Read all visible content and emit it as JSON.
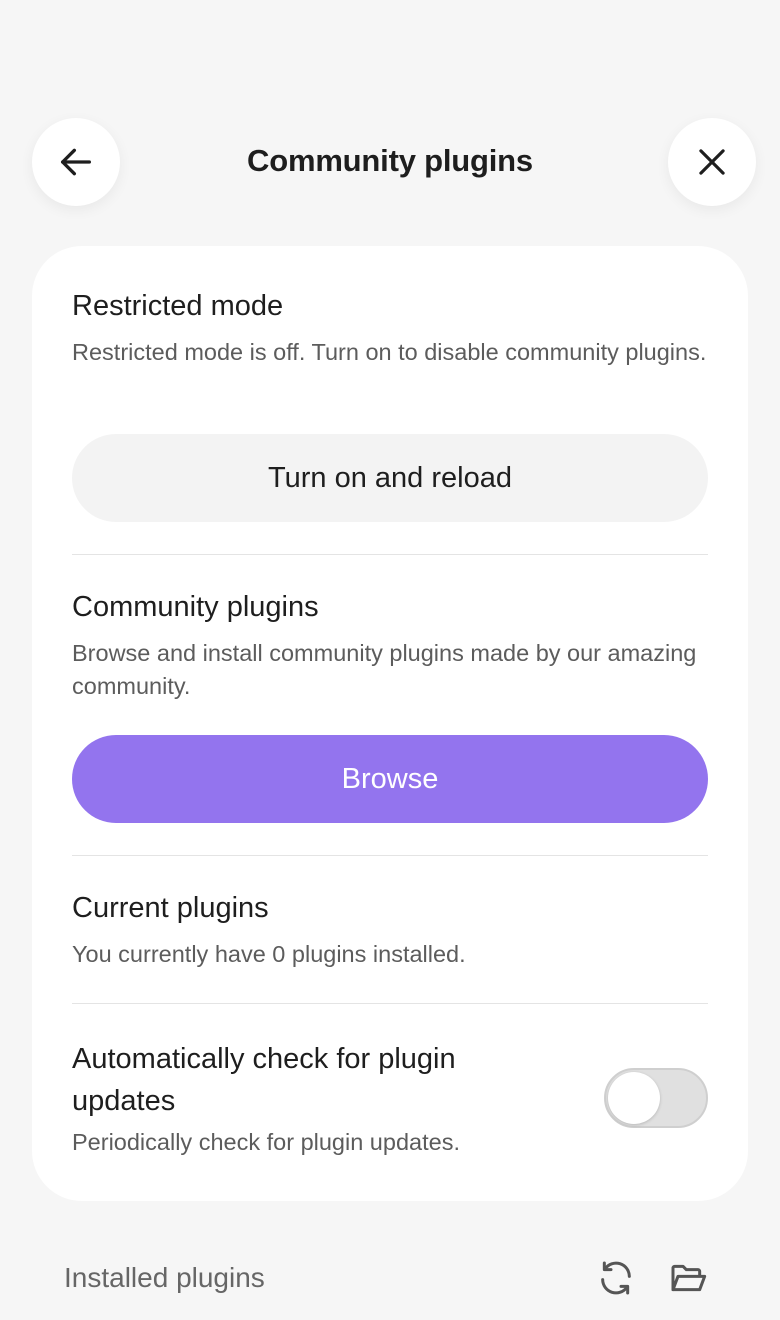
{
  "header": {
    "title": "Community plugins",
    "back_icon": "arrow-left-icon",
    "close_icon": "close-icon"
  },
  "restricted_mode": {
    "title": "Restricted mode",
    "description": "Restricted mode is off. Turn on to disable community plugins.",
    "button_label": "Turn on and reload"
  },
  "community_plugins": {
    "title": "Community plugins",
    "description": "Browse and install community plugins made by our amazing community.",
    "button_label": "Browse"
  },
  "current_plugins": {
    "title": "Current plugins",
    "description": "You currently have 0 plugins installed."
  },
  "auto_update": {
    "title": "Automatically check for plugin updates",
    "description": "Periodically check for plugin updates.",
    "enabled": false
  },
  "footer": {
    "label": "Installed plugins",
    "icons": [
      "reload-icon",
      "folder-icon"
    ]
  },
  "colors": {
    "accent": "#9374ee",
    "background": "#f6f6f6",
    "card": "#ffffff"
  }
}
